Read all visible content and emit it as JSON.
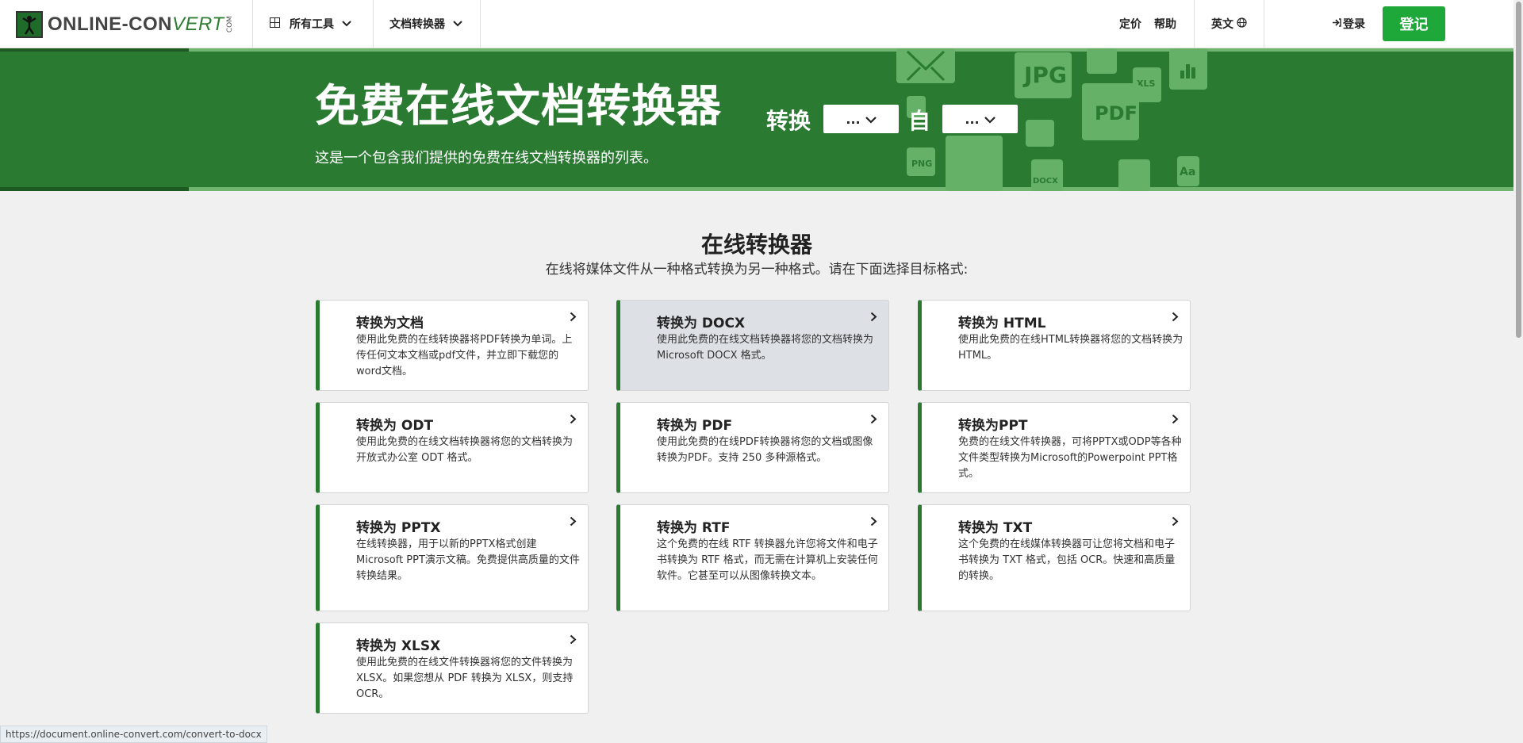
{
  "header": {
    "logo_main": "ONLINE-CON",
    "logo_italic": "VERT",
    "logo_com": "COM",
    "nav_all_tools": "所有工具",
    "nav_doc_converter": "文档转换器",
    "nav_pricing": "定价",
    "nav_help": "帮助",
    "nav_language": "英文",
    "nav_login": "登录",
    "signup_label": "登记"
  },
  "hero": {
    "title": "免费在线文档转换器",
    "subtitle": "这是一个包含我们提供的免费在线文档转换器的列表。",
    "convert_label": "转换",
    "to_select": "...",
    "from_label": "自",
    "from_select": "...",
    "deco_labels": [
      "JPG",
      "PDF",
      "XLS",
      "PNG",
      "DOCX",
      "Aa"
    ]
  },
  "main": {
    "title": "在线转换器",
    "subtitle": "在线将媒体文件从一种格式转换为另一种格式。请在下面选择目标格式:",
    "cards": [
      {
        "title": "转换为文档",
        "desc": "使用此免费的在线转换器将PDF转换为单词。上传任何文本文档或pdf文件，并立即下载您的word文档。"
      },
      {
        "title": "转换为 DOCX",
        "desc": "使用此免费的在线文档转换器将您的文档转换为Microsoft DOCX 格式。"
      },
      {
        "title": "转换为 HTML",
        "desc": "使用此免费的在线HTML转换器将您的文档转换为HTML。"
      },
      {
        "title": "转换为 ODT",
        "desc": "使用此免费的在线文档转换器将您的文档转换为开放式办公室 ODT 格式。"
      },
      {
        "title": "转换为 PDF",
        "desc": "使用此免费的在线PDF转换器将您的文档或图像转换为PDF。支持 250 多种源格式。"
      },
      {
        "title": "转换为PPT",
        "desc": "免费的在线文件转换器，可将PPTX或ODP等各种文件类型转换为Microsoft的Powerpoint PPT格式。"
      },
      {
        "title": "转换为 PPTX",
        "desc": "在线转换器，用于以新的PPTX格式创建Microsoft PPT演示文稿。免费提供高质量的文件转换结果。"
      },
      {
        "title": "转换为 RTF",
        "desc": "这个免费的在线 RTF 转换器允许您将文件和电子书转换为 RTF 格式，而无需在计算机上安装任何软件。它甚至可以从图像转换文本。"
      },
      {
        "title": "转换为 TXT",
        "desc": "这个免费的在线媒体转换器可让您将文档和电子书转换为 TXT 格式，包括 OCR。快速和高质量的转换。"
      },
      {
        "title": "转换为 XLSX",
        "desc": "使用此免费的在线文件转换器将您的文件转换为 XLSX。如果您想从 PDF 转换为 XLSX，则支持 OCR。"
      }
    ]
  },
  "status_url": "https://document.online-convert.com/convert-to-docx",
  "colors": {
    "brand_green": "#2a7a32",
    "signup_green": "#1fa83a"
  }
}
